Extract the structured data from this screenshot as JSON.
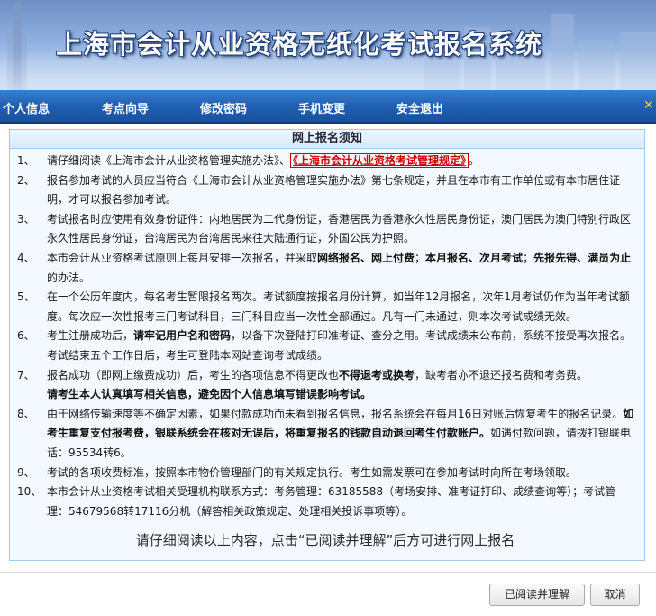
{
  "banner": {
    "title": "上海市会计从业资格无纸化考试报名系统"
  },
  "nav": {
    "items": [
      {
        "label": "个人信息"
      },
      {
        "label": "考点向导"
      },
      {
        "label": "修改密码"
      },
      {
        "label": "手机变更"
      },
      {
        "label": "安全退出"
      }
    ]
  },
  "notice": {
    "title": "网上报名须知",
    "items": [
      {
        "num": "1、",
        "pre": "请仔细阅读《上海市会计从业资格管理实施办法》、",
        "link": "《上海市会计从业资格考试管理规定》",
        "post": "。"
      },
      {
        "num": "2、",
        "text": "报名参加考试的人员应当符合《上海市会计从业资格管理实施办法》第七条规定，并且在本市有工作单位或有本市居住证明，才可以报名参加考试。"
      },
      {
        "num": "3、",
        "text": "考试报名时应使用有效身份证件：内地居民为二代身份证，香港居民为香港永久性居民身份证，澳门居民为澳门特别行政区永久性居民身份证，台湾居民为台湾居民来往大陆通行证，外国公民为护照。"
      },
      {
        "num": "4、",
        "a": "本市会计从业资格考试原则上每月安排一次报名，并采取",
        "b": "网络报名、网上付费",
        "c": "；",
        "d": "本月报名、次月考试",
        "e": "；",
        "f": "先报先得、满员为止",
        "g": "的办法。"
      },
      {
        "num": "5、",
        "text": "在一个公历年度内，每名考生暂限报名两次。考试额度按报名月份计算，如当年12月报名，次年1月考试仍作为当年考试额度。每次应一次性报考三门考试科目，三门科目应当一次性全部通过。凡有一门未通过，则本次考试成绩无效。"
      },
      {
        "num": "6、",
        "a": "考生注册成功后，",
        "b": "请牢记用户名和密码",
        "c": "，以备下次登陆打印准考证、查分之用。考试成绩未公布前，系统不接受再次报名。考试结束五个工作日后，考生可登陆本网站查询考试成绩。"
      },
      {
        "num": "7、",
        "a": "报名成功（即网上缴费成功）后，考生的各项信息不得更改也",
        "b": "不得退考或换考",
        "c": "，缺考者亦不退还报名费和考务费。",
        "d": "请考生本人认真填写相关信息，避免因个人信息填写错误影响考试。"
      },
      {
        "num": "8、",
        "a": "由于网络传输速度等不确定因素，如果付款成功而未看到报名信息，报名系统会在每月16日对账后恢复考生的报名记录。",
        "b": "如考生重复支付报考费，银联系统会在核对无误后，将重复报名的钱款自动退回考生付款账户。",
        "c": "如遇付款问题，请拨打银联电话：95534转6。"
      },
      {
        "num": "9、",
        "text": "考试的各项收费标准，按照本市物价管理部门的有关规定执行。考生如需发票可在参加考试时向所在考场领取。"
      },
      {
        "num": "10、",
        "text": "本市会计从业资格考试相关受理机构联系方式：考务管理：63185588（考场安排、准考证打印、成绩查询等）；考试管理：54679568转17116分机（解答相关政策规定、处理相关投诉事项等）。"
      }
    ],
    "footer": "请仔细阅读以上内容，点击“已阅读并理解”后方可进行网上报名"
  },
  "buttons": {
    "agree": "已阅读并理解",
    "cancel": "取消"
  }
}
